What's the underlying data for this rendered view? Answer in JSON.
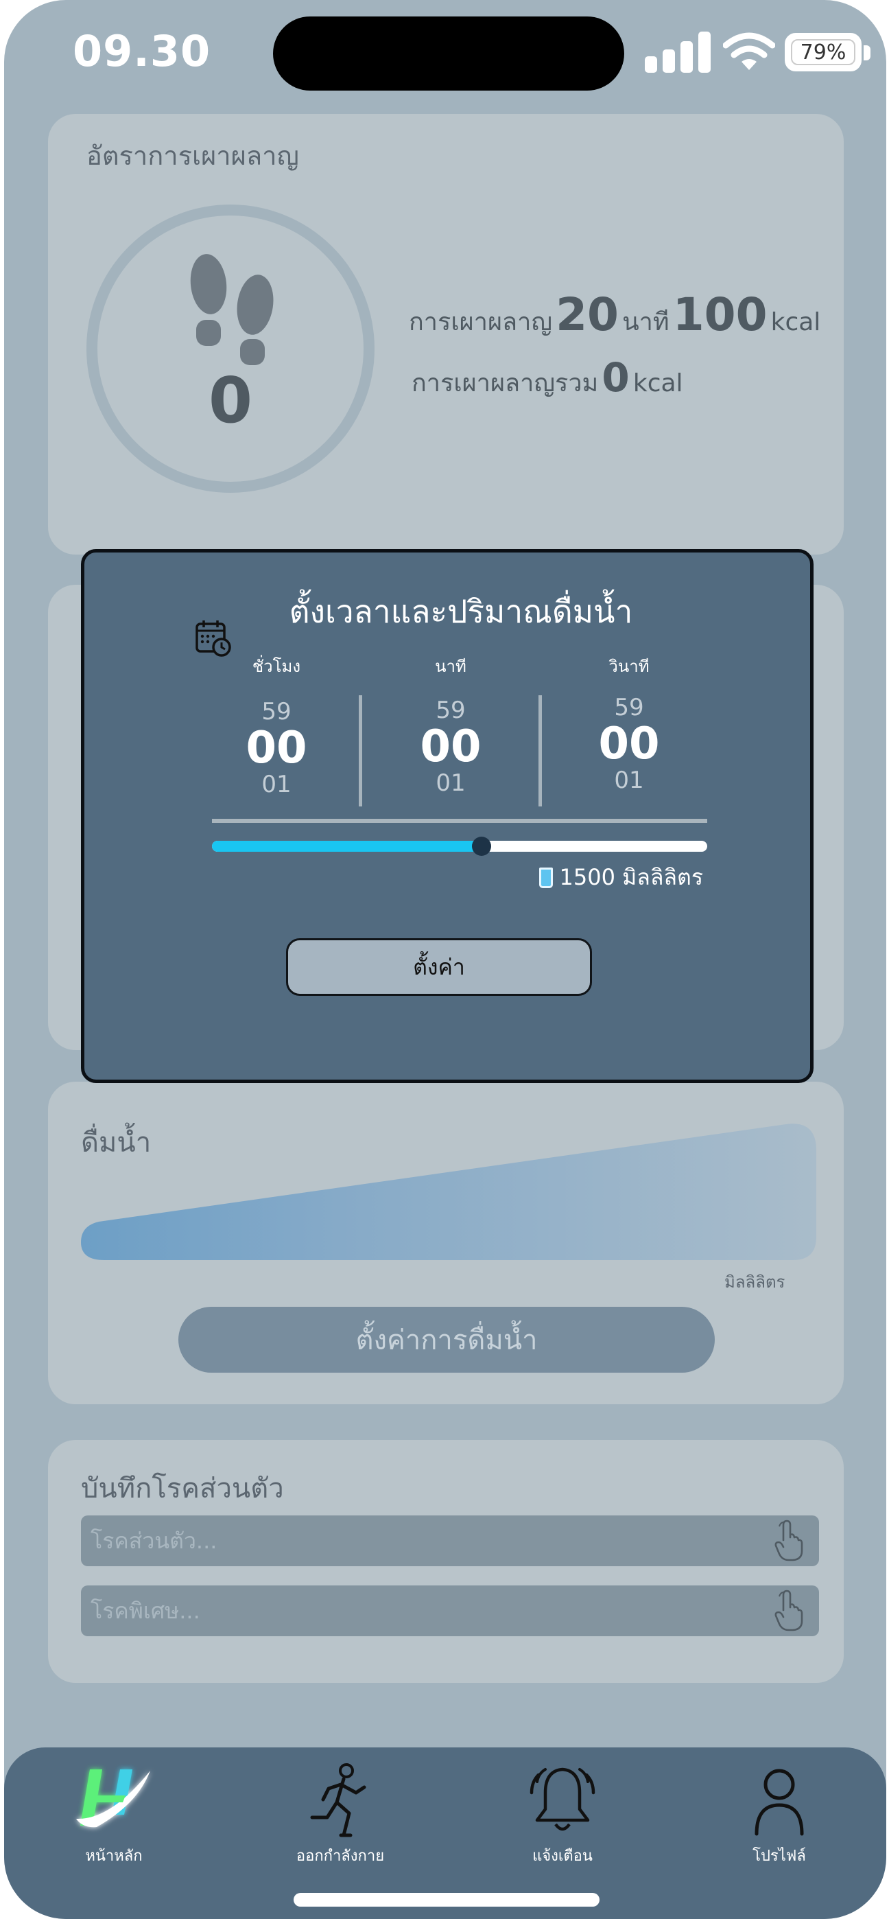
{
  "status_bar": {
    "time": "09.30",
    "battery": "79%"
  },
  "burn_card": {
    "title": "อัตราการเผาผลาญ",
    "steps": "0",
    "burn_label": "การเผาผลาญ",
    "minutes": "20",
    "minutes_unit": "นาที",
    "kcal": "100",
    "kcal_unit": "kcal",
    "total_label": "การเผาผลาญรวม",
    "total": "0",
    "total_unit": "kcal"
  },
  "modal": {
    "title": "ตั้งเวลาและปริมาณดื่มน้ำ",
    "hours_label": "ชั่วโมง",
    "minutes_label": "นาที",
    "seconds_label": "วินาที",
    "hours": {
      "prev": "59",
      "current": "00",
      "next": "01"
    },
    "minutes": {
      "prev": "59",
      "current": "00",
      "next": "01"
    },
    "seconds": {
      "prev": "59",
      "current": "00",
      "next": "01"
    },
    "amount_fraction": 0.545,
    "amount": "1500 มิลลิลิตร",
    "set_button": "ตั้งค่า"
  },
  "water_card": {
    "title": "ดื่มน้ำ",
    "unit": "มิลลิลิตร",
    "button": "ตั้งค่าการดื่มน้ำ"
  },
  "disease_card": {
    "title": "บันทึกโรคส่วนตัว",
    "personal_placeholder": "โรคส่วนตัว...",
    "special_placeholder": "โรคพิเศษ..."
  },
  "tabs": [
    {
      "label": "หน้าหลัก",
      "icon": "home-logo-icon"
    },
    {
      "label": "ออกกำลังกาย",
      "icon": "running-icon"
    },
    {
      "label": "แจ้งเตือน",
      "icon": "bell-icon"
    },
    {
      "label": "โปรไฟล์",
      "icon": "user-icon"
    }
  ],
  "colors": {
    "background": "#a2b3be",
    "card": "#b9c4ca",
    "modal": "#526b80",
    "accent": "#19c6f2",
    "tabbar": "#526b80"
  }
}
